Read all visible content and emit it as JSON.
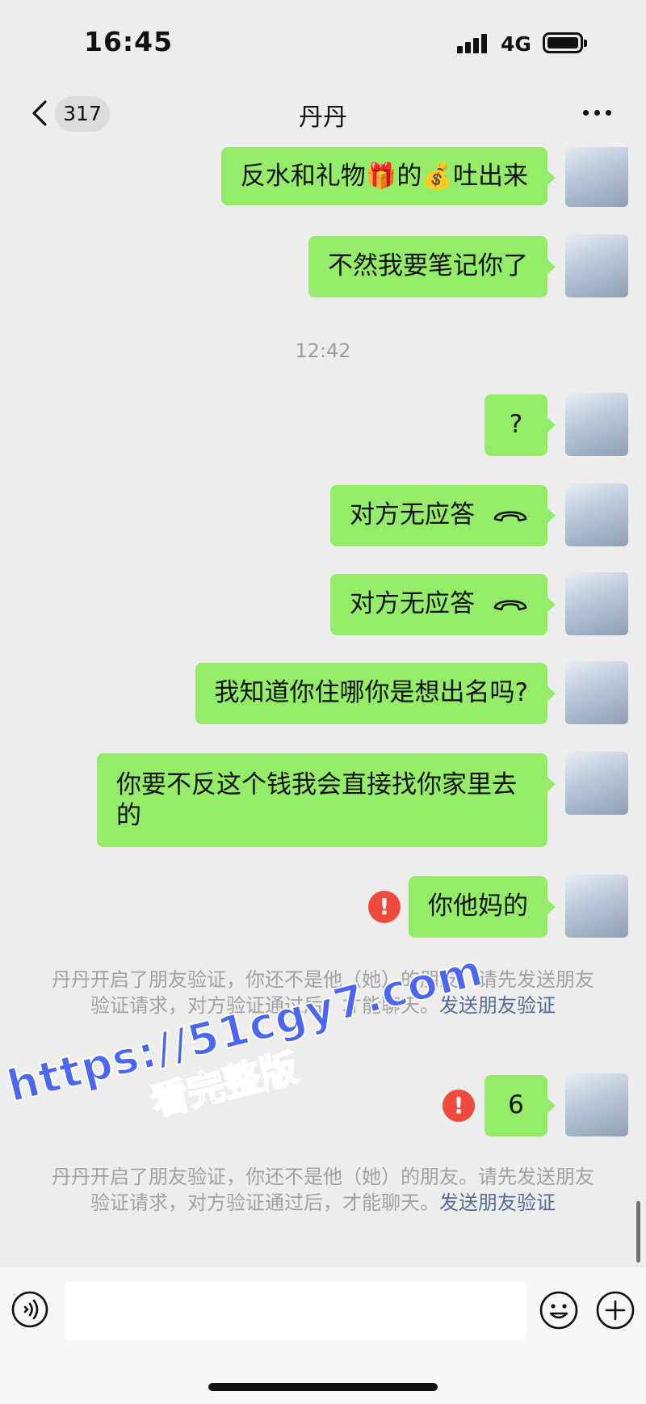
{
  "status_bar": {
    "time": "16:45",
    "network": "4G"
  },
  "nav": {
    "unread_count": "317",
    "title": "丹丹"
  },
  "messages": [
    {
      "text": "反水和礼物🎁的💰吐出来"
    },
    {
      "text": "不然我要笔记你了"
    },
    {
      "time": "12:42"
    },
    {
      "text": "?"
    },
    {
      "text": "对方无应答",
      "icon": "call-declined-icon"
    },
    {
      "text": "对方无应答",
      "icon": "call-declined-icon"
    },
    {
      "text": "我知道你住哪你是想出名吗?"
    },
    {
      "text": "你要不反这个钱我会直接找你家里去的"
    },
    {
      "text": "你他妈的",
      "failed": true
    },
    {
      "text": "6",
      "failed": true
    }
  ],
  "system_notice": {
    "text": "丹丹开启了朋友验证，你还不是他（她）的朋友。请先发送朋友验证请求，对方验证通过后，才能聊天。",
    "link": "发送朋友验证"
  },
  "watermark": {
    "line1": "https://51cgy7.com",
    "line2": "看完整版"
  },
  "icons": {
    "back": "chevron-left-icon",
    "more": "more-dots-icon",
    "voice": "voice-icon",
    "emoji": "emoji-icon",
    "plus": "plus-icon",
    "error": "error-icon",
    "call": "call-declined-icon"
  },
  "colors": {
    "background": "#ededed",
    "bubble": "#95ec69",
    "error": "#f04a3f",
    "link": "#576b95",
    "watermark": "#4a66f2"
  }
}
